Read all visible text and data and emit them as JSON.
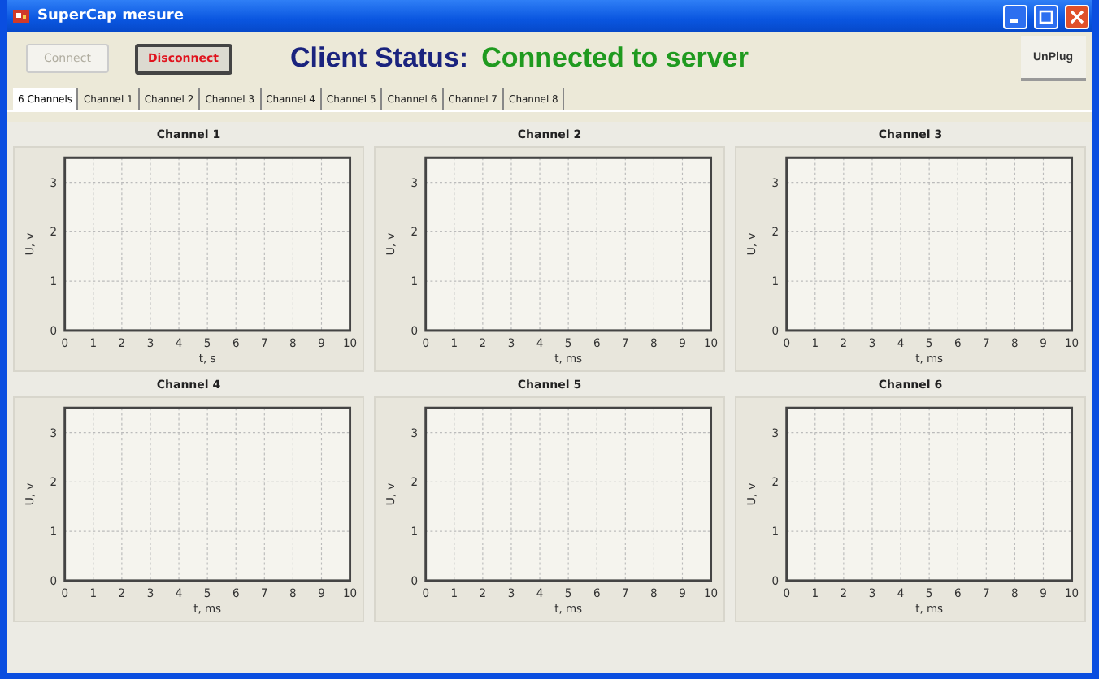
{
  "window": {
    "title": "SuperCap mesure"
  },
  "buttons": [
    {
      "label": "Connect",
      "disabled": true,
      "kind": "plain"
    },
    {
      "label": "Disconnect",
      "disabled": false,
      "kind": "alert"
    }
  ],
  "status": {
    "label": "Client Status:",
    "value": "Connected to server"
  },
  "unplug_button": {
    "label": "UnPlug"
  },
  "tabs": [
    {
      "label": "6 Channels",
      "selected": true
    },
    {
      "label": "Channel 1",
      "selected": false
    },
    {
      "label": "Channel 2",
      "selected": false
    },
    {
      "label": "Channel 3",
      "selected": false
    },
    {
      "label": "Channel 4",
      "selected": false
    },
    {
      "label": "Channel 5",
      "selected": false
    },
    {
      "label": "Channel 6",
      "selected": false
    },
    {
      "label": "Channel 7",
      "selected": false
    },
    {
      "label": "Channel 8",
      "selected": false
    }
  ],
  "charts": [
    {
      "chart_data": {
        "grid": true,
        "type": "line",
        "title": "Channel 1",
        "xlabel": "t, s",
        "ylabel": "U, v",
        "xlim": [
          0,
          10
        ],
        "ylim": [
          0,
          3.5
        ],
        "xticks": [
          0,
          1,
          2,
          3,
          4,
          5,
          6,
          7,
          8,
          9,
          10
        ],
        "yticks": [
          0,
          1,
          2,
          3
        ]
      }
    },
    {
      "chart_data": {
        "grid": true,
        "type": "line",
        "title": "Channel 2",
        "xlabel": "t, ms",
        "ylabel": "U, v",
        "xlim": [
          0,
          10
        ],
        "ylim": [
          0,
          3.5
        ],
        "xticks": [
          0,
          1,
          2,
          3,
          4,
          5,
          6,
          7,
          8,
          9,
          10
        ],
        "yticks": [
          0,
          1,
          2,
          3
        ]
      }
    },
    {
      "chart_data": {
        "grid": true,
        "type": "line",
        "title": "Channel 3",
        "xlabel": "t, ms",
        "ylabel": "U, v",
        "xlim": [
          0,
          10
        ],
        "ylim": [
          0,
          3.5
        ],
        "xticks": [
          0,
          1,
          2,
          3,
          4,
          5,
          6,
          7,
          8,
          9,
          10
        ],
        "yticks": [
          0,
          1,
          2,
          3
        ]
      }
    },
    {
      "chart_data": {
        "grid": true,
        "type": "line",
        "title": "Channel 4",
        "xlabel": "t, ms",
        "ylabel": "U, v",
        "xlim": [
          0,
          10
        ],
        "ylim": [
          0,
          3.5
        ],
        "xticks": [
          0,
          1,
          2,
          3,
          4,
          5,
          6,
          7,
          8,
          9,
          10
        ],
        "yticks": [
          0,
          1,
          2,
          3
        ]
      }
    },
    {
      "chart_data": {
        "grid": true,
        "type": "line",
        "title": "Channel 5",
        "xlabel": "t, ms",
        "ylabel": "U, v",
        "xlim": [
          0,
          10
        ],
        "ylim": [
          0,
          3.5
        ],
        "xticks": [
          0,
          1,
          2,
          3,
          4,
          5,
          6,
          7,
          8,
          9,
          10
        ],
        "yticks": [
          0,
          1,
          2,
          3
        ]
      }
    },
    {
      "chart_data": {
        "grid": true,
        "type": "line",
        "title": "Channel 6",
        "xlabel": "t, ms",
        "ylabel": "U, v",
        "xlim": [
          0,
          10
        ],
        "ylim": [
          0,
          3.5
        ],
        "xticks": [
          0,
          1,
          2,
          3,
          4,
          5,
          6,
          7,
          8,
          9,
          10
        ],
        "yticks": [
          0,
          1,
          2,
          3
        ]
      }
    }
  ]
}
